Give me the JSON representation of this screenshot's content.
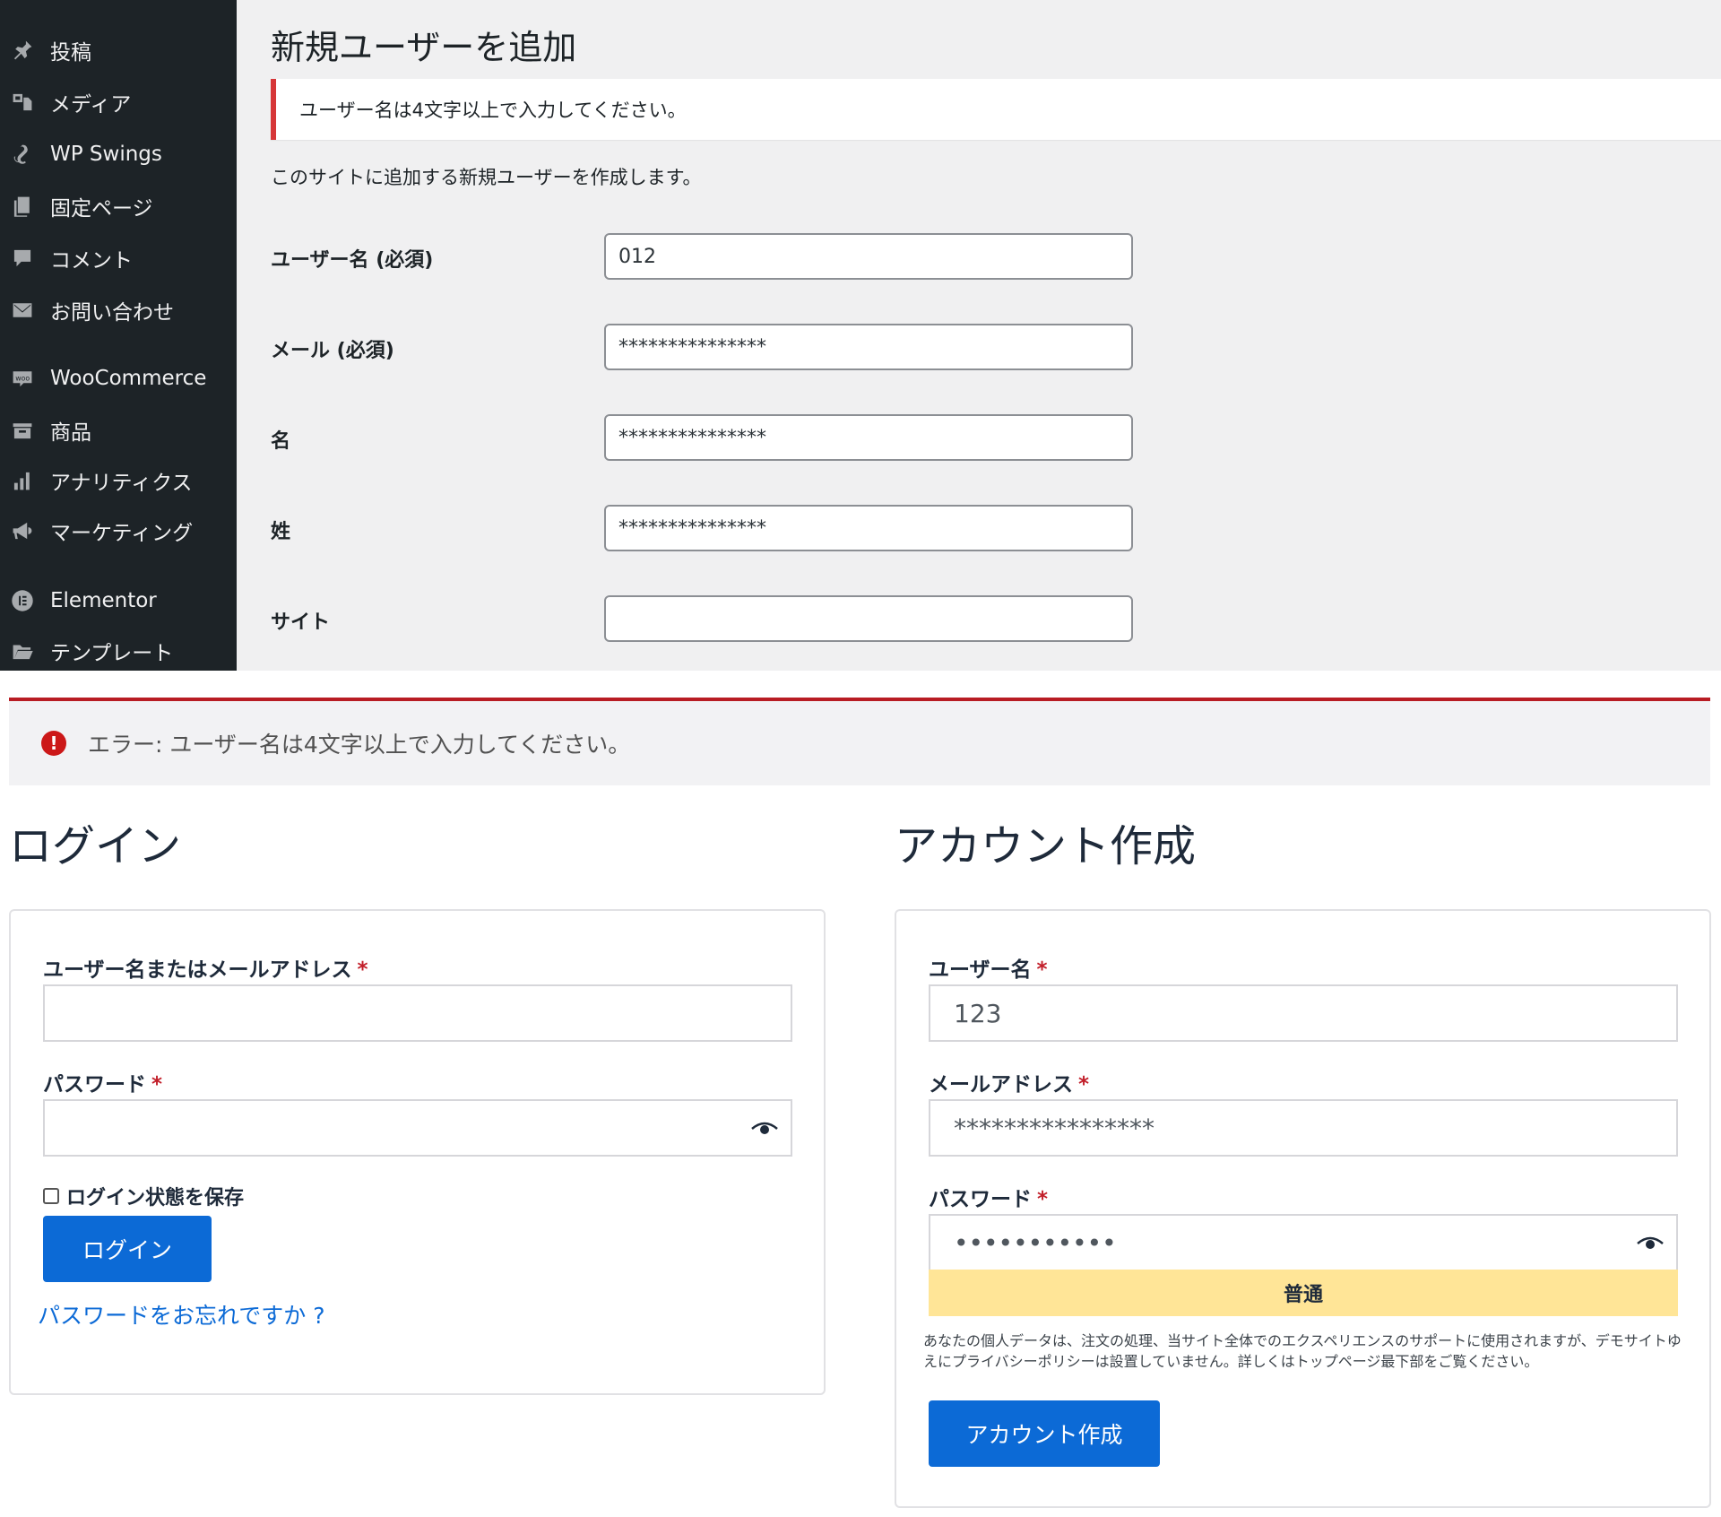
{
  "wp_admin": {
    "sidebar": {
      "items": [
        {
          "label": "投稿",
          "icon": "pin-icon"
        },
        {
          "label": "メディア",
          "icon": "media-icon"
        },
        {
          "label": "WP Swings",
          "icon": "wp-swings-icon"
        },
        {
          "label": "固定ページ",
          "icon": "page-icon"
        },
        {
          "label": "コメント",
          "icon": "comment-icon"
        },
        {
          "label": "お問い合わせ",
          "icon": "mail-icon"
        },
        {
          "label": "WooCommerce",
          "icon": "woo-icon"
        },
        {
          "label": "商品",
          "icon": "archive-icon"
        },
        {
          "label": "アナリティクス",
          "icon": "bar-chart-icon"
        },
        {
          "label": "マーケティング",
          "icon": "megaphone-icon"
        },
        {
          "label": "Elementor",
          "icon": "elementor-icon"
        },
        {
          "label": "テンプレート",
          "icon": "folder-icon"
        }
      ]
    },
    "page_title": "新規ユーザーを追加",
    "notice": "ユーザー名は4文字以上で入力してください。",
    "description": "このサイトに追加する新規ユーザーを作成します。",
    "fields": [
      {
        "label": "ユーザー名 (必須)",
        "value": "012"
      },
      {
        "label": "メール (必須)",
        "value": "***************"
      },
      {
        "label": "名",
        "value": "***************"
      },
      {
        "label": "姓",
        "value": "***************"
      },
      {
        "label": "サイト",
        "value": ""
      }
    ]
  },
  "error": {
    "icon": "!",
    "text": "エラー: ユーザー名は4文字以上で入力してください。"
  },
  "login": {
    "heading": "ログイン",
    "username_label": "ユーザー名またはメールアドレス",
    "username_value": "",
    "password_label": "パスワード",
    "password_value": "",
    "required_mark": "*",
    "remember_label": "ログイン状態を保存",
    "button_label": "ログイン",
    "lost_password": "パスワードをお忘れですか ?"
  },
  "register": {
    "heading": "アカウント作成",
    "username_label": "ユーザー名",
    "username_value": "123",
    "email_label": "メールアドレス",
    "email_value": "****************",
    "password_label": "パスワード",
    "password_value": "•••••••••••",
    "required_mark": "*",
    "strength": "普通",
    "privacy": "あなたの個人データは、注文の処理、当サイト全体でのエクスペリエンスのサポートに使用されますが、デモサイトゆえにプライバシーポリシーは設置していません。詳しくはトップページ最下部をご覧ください。",
    "button_label": "アカウント作成"
  },
  "colors": {
    "sidebar_bg": "#1d2327",
    "error_red": "#d63638",
    "woo_blue": "#0c6ad6",
    "strength_yellow": "#ffe597"
  }
}
